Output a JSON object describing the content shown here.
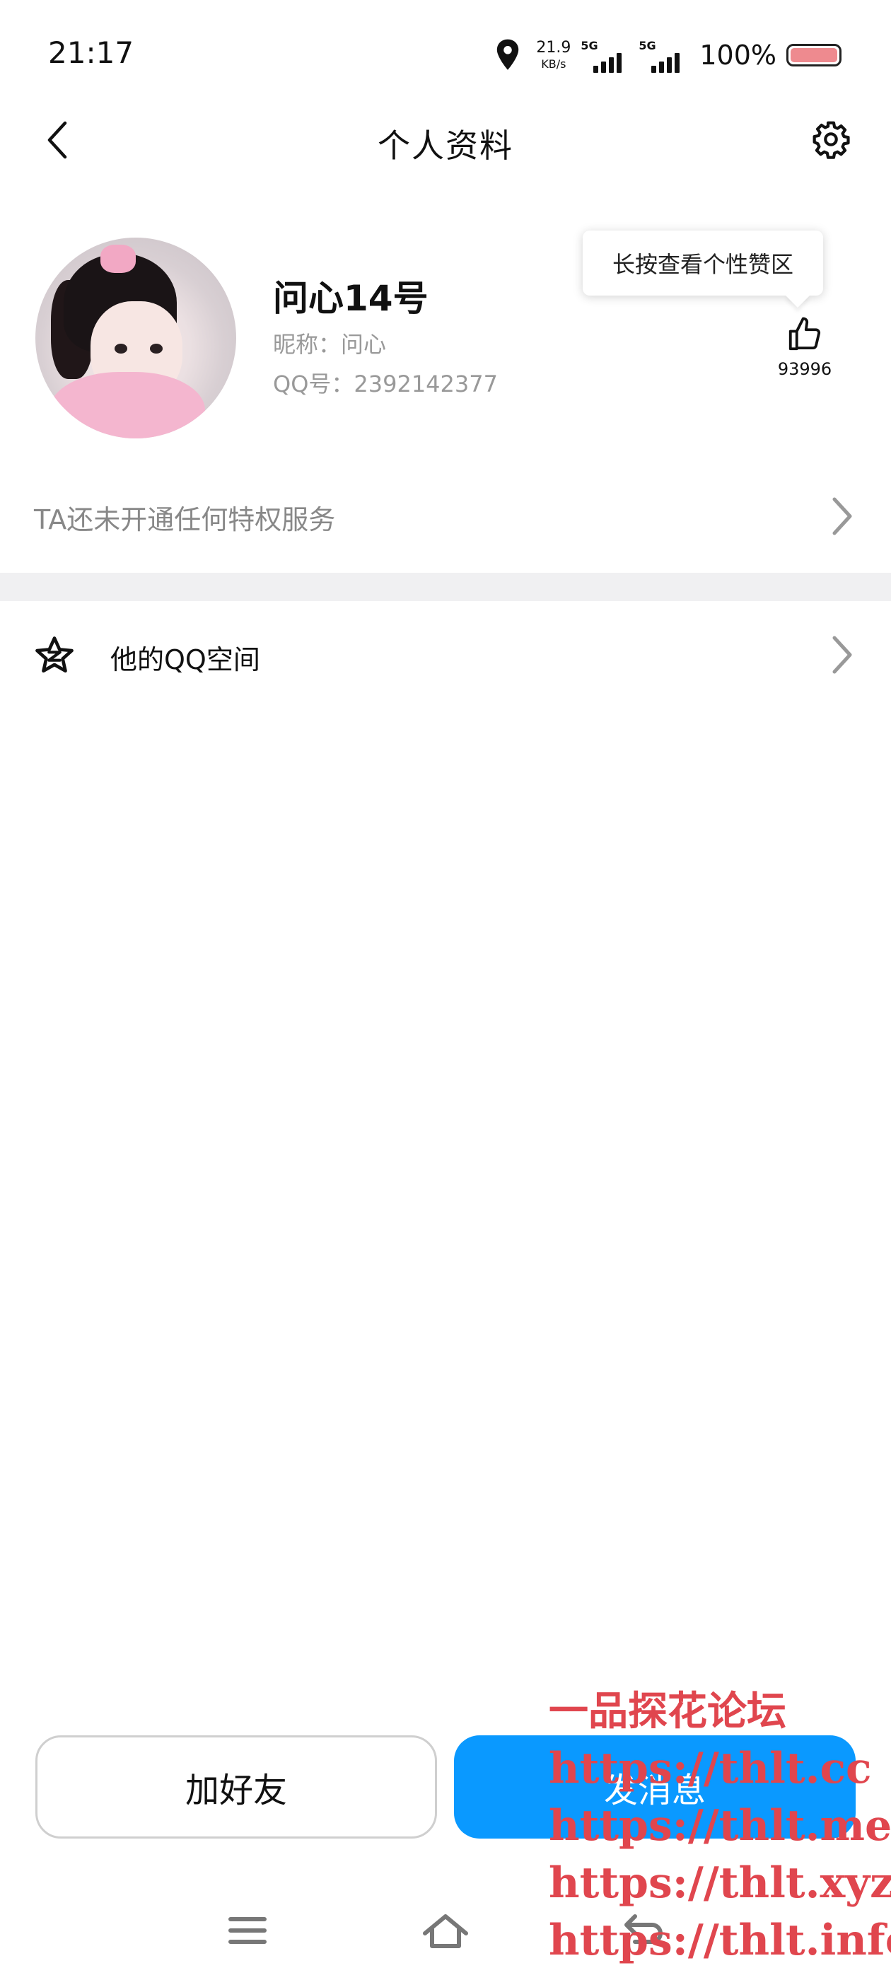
{
  "status_bar": {
    "time": "21:17",
    "net_speed_value": "21.9",
    "net_speed_unit": "KB/s",
    "sim1_label": "5G",
    "sim2_label": "5G",
    "battery_text": "100%",
    "battery_level_percent": 100,
    "battery_color": "#ee8a8f"
  },
  "header": {
    "title": "个人资料",
    "back_icon": "chevron-left-icon",
    "settings_icon": "gear-icon"
  },
  "profile": {
    "name": "问心14号",
    "nickname": "昵称：问心",
    "qq_number": "QQ号：2392142377",
    "like_tooltip": "长按查看个性赞区",
    "like_count": "93996",
    "like_icon": "thumbs-up-icon"
  },
  "rows": {
    "privilege": "TA还未开通任何特权服务",
    "qzone": "他的QQ空间",
    "qzone_icon": "star-icon"
  },
  "buttons": {
    "add_friend": "加好友",
    "send_message": "发消息",
    "accent_color": "#0a99ff"
  },
  "system_nav": {
    "menu_icon": "menu-icon",
    "home_icon": "home-icon",
    "back_icon": "return-icon"
  },
  "watermark": {
    "lines": [
      "一品探花论坛",
      "https://thlt.cc",
      "https://thlt.me",
      "https://thlt.xyz",
      "https://thlt.info"
    ],
    "color": "#e0464e"
  }
}
